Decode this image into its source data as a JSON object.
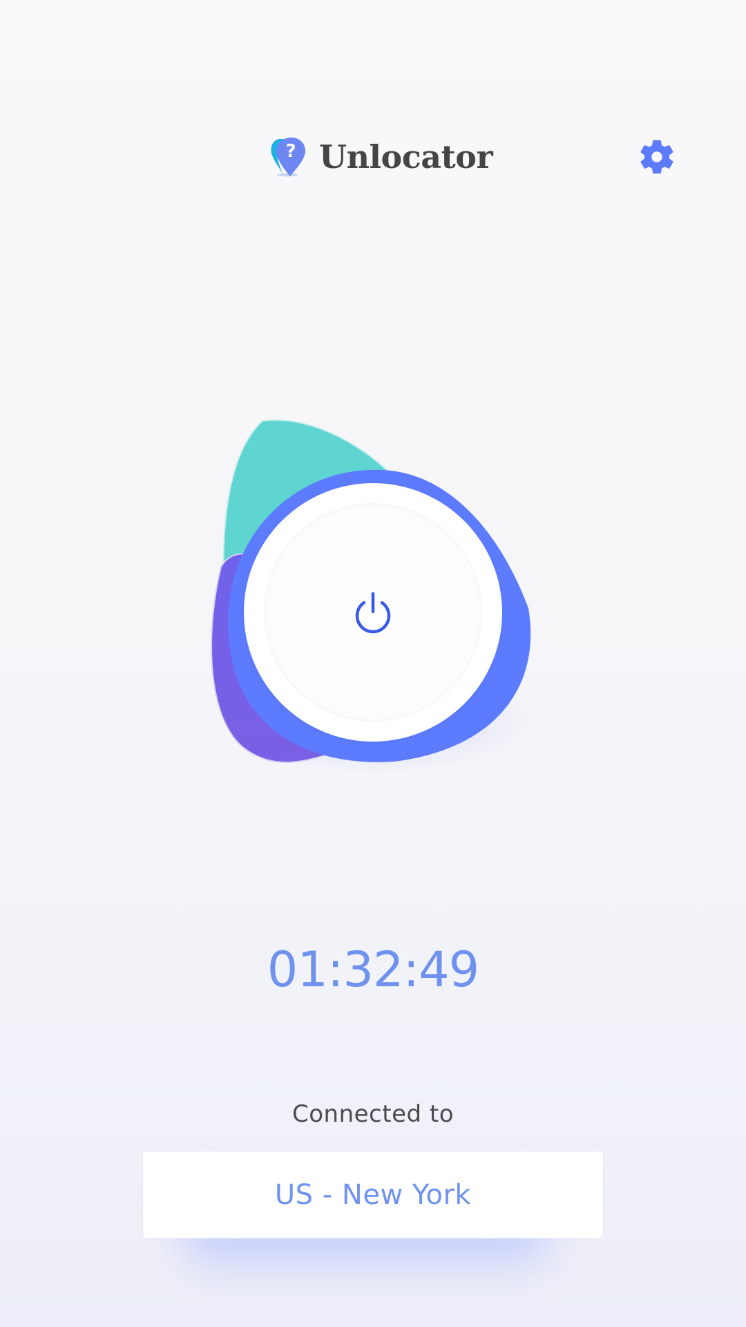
{
  "header": {
    "app_name": "Unlocator",
    "logo_icon": "location-pin-question-icon",
    "settings_icon": "gear-icon"
  },
  "power": {
    "icon": "power-icon",
    "state": "connected"
  },
  "status": {
    "timer": "01:32:49",
    "connected_label": "Connected to",
    "location": "US - New York"
  },
  "colors": {
    "accent_blue": "#5d7bff",
    "teal": "#5fd5d2",
    "purple": "#7a5ee6",
    "timer_text": "#6f92ee",
    "title_text": "#454548",
    "power_icon": "#3a5ae8"
  }
}
